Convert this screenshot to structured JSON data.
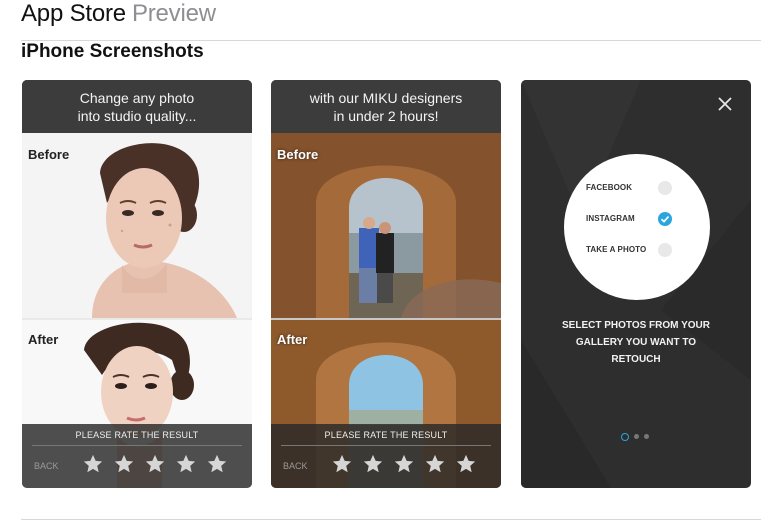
{
  "header": {
    "app_store": "App Store",
    "preview": "Preview"
  },
  "section": {
    "title": "iPhone Screenshots"
  },
  "screenshots": [
    {
      "headline": [
        "Change any photo",
        "into studio quality..."
      ],
      "before_label": "Before",
      "after_label": "After",
      "rate_title": "PLEASE RATE THE RESULT",
      "back_label": "BACK",
      "stars": 5
    },
    {
      "headline": [
        "with our MIKU designers",
        "in under 2 hours!"
      ],
      "before_label": "Before",
      "after_label": "After",
      "rate_title": "PLEASE RATE THE RESULT",
      "back_label": "BACK",
      "stars": 5
    },
    {
      "options": [
        {
          "label": "FACEBOOK",
          "checked": false
        },
        {
          "label": "INSTAGRAM",
          "checked": true
        },
        {
          "label": "TAKE A PHOTO",
          "checked": false
        }
      ],
      "message": [
        "SELECT PHOTOS FROM YOUR",
        "GALLERY YOU WANT TO",
        "RETOUCH"
      ],
      "page_dots": 3,
      "active_dot": 0,
      "close_icon": "close-icon"
    }
  ],
  "colors": {
    "accent": "#2aa6df",
    "header_bg": "#3c3c3c",
    "dark_bg": "#2e2e2e"
  }
}
